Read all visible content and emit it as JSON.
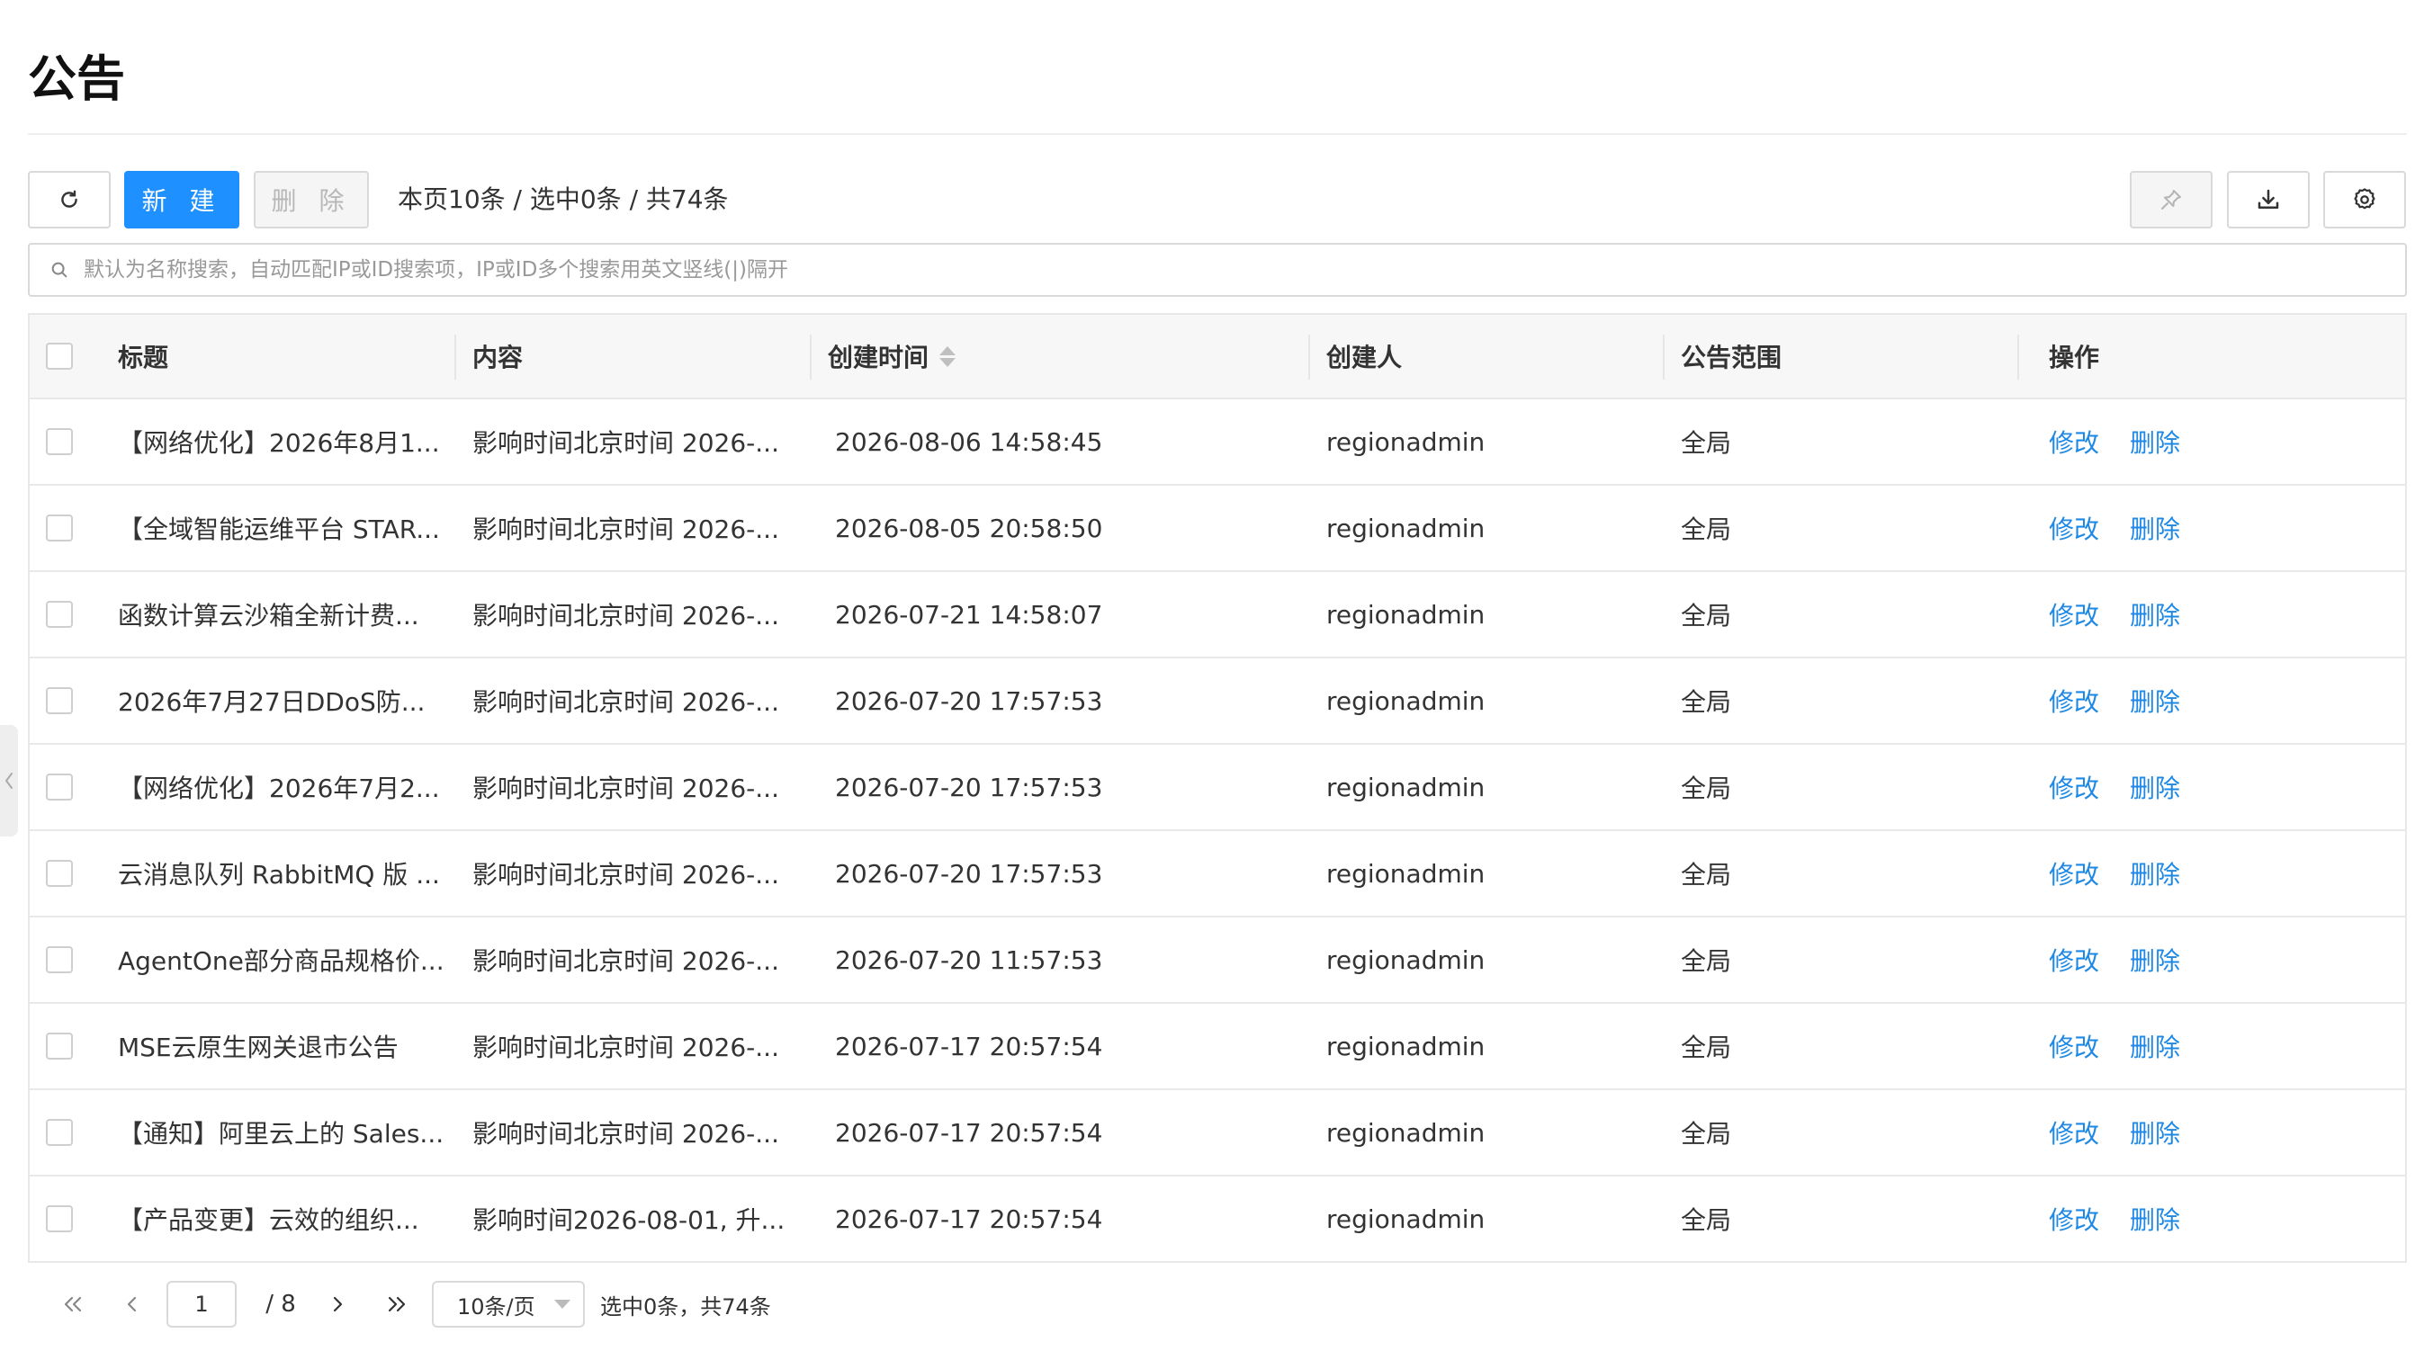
{
  "page": {
    "title": "公告"
  },
  "toolbar": {
    "new_label": "新 建",
    "delete_label": "删 除",
    "summary": "本页10条 / 选中0条 / 共74条"
  },
  "search": {
    "placeholder": "默认为名称搜索，自动匹配IP或ID搜索项，IP或ID多个搜索用英文竖线(|)隔开"
  },
  "table": {
    "columns": [
      "标题",
      "内容",
      "创建时间",
      "创建人",
      "公告范围",
      "操作"
    ],
    "rows": [
      {
        "title": "【网络优化】2026年8月1...",
        "content": "影响时间北京时间 2026-...",
        "time": "2026-08-06 14:58:45",
        "creator": "regionadmin",
        "scope": "全局"
      },
      {
        "title": "【全域智能运维平台 STAR...",
        "content": "影响时间北京时间 2026-...",
        "time": "2026-08-05 20:58:50",
        "creator": "regionadmin",
        "scope": "全局"
      },
      {
        "title": "函数计算云沙箱全新计费...",
        "content": "影响时间北京时间 2026-...",
        "time": "2026-07-21 14:58:07",
        "creator": "regionadmin",
        "scope": "全局"
      },
      {
        "title": "2026年7月27日DDoS防...",
        "content": "影响时间北京时间 2026-...",
        "time": "2026-07-20 17:57:53",
        "creator": "regionadmin",
        "scope": "全局"
      },
      {
        "title": "【网络优化】2026年7月2...",
        "content": "影响时间北京时间 2026-...",
        "time": "2026-07-20 17:57:53",
        "creator": "regionadmin",
        "scope": "全局"
      },
      {
        "title": "云消息队列 RabbitMQ 版 ...",
        "content": "影响时间北京时间 2026-...",
        "time": "2026-07-20 17:57:53",
        "creator": "regionadmin",
        "scope": "全局"
      },
      {
        "title": "AgentOne部分商品规格价...",
        "content": "影响时间北京时间 2026-...",
        "time": "2026-07-20 11:57:53",
        "creator": "regionadmin",
        "scope": "全局"
      },
      {
        "title": "MSE云原生网关退市公告",
        "content": "影响时间北京时间 2026-...",
        "time": "2026-07-17 20:57:54",
        "creator": "regionadmin",
        "scope": "全局"
      },
      {
        "title": "【通知】阿里云上的 Sales...",
        "content": "影响时间北京时间 2026-...",
        "time": "2026-07-17 20:57:54",
        "creator": "regionadmin",
        "scope": "全局"
      },
      {
        "title": "【产品变更】云效的组织...",
        "content": "影响时间2026-08-01, 升...",
        "time": "2026-07-17 20:57:54",
        "creator": "regionadmin",
        "scope": "全局"
      }
    ],
    "actions": {
      "edit": "修改",
      "delete": "删除"
    }
  },
  "pagination": {
    "current_page": "1",
    "total_pages": "/ 8",
    "page_size": "10条/页",
    "info": "选中0条，共74条"
  },
  "colors": {
    "primary": "#1e90ff",
    "link": "#1e88e5",
    "border": "#d9d9d9",
    "header_bg": "#f7f7f7"
  },
  "icons": [
    "refresh-icon",
    "pin-icon",
    "download-icon",
    "settings-icon",
    "search-icon",
    "sort-icon",
    "first-page-icon",
    "prev-page-icon",
    "next-page-icon",
    "last-page-icon",
    "collapse-left-icon"
  ]
}
